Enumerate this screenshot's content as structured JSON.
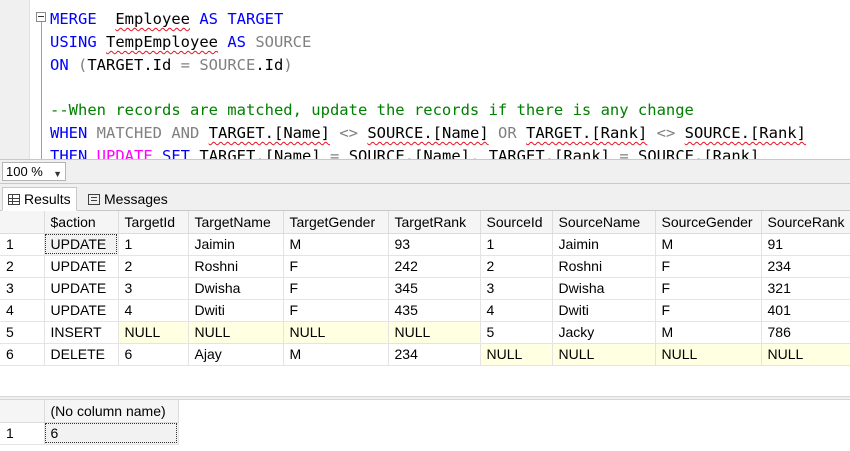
{
  "editor": {
    "lines": [
      [
        [
          "kw",
          "MERGE"
        ],
        [
          "",
          "  "
        ],
        [
          "sq",
          "Employee"
        ],
        [
          "",
          ""
        ],
        [
          "kw",
          " AS TARGET"
        ]
      ],
      [
        [
          "kw",
          "USING"
        ],
        [
          "",
          " "
        ],
        [
          "sq",
          "TempEmployee"
        ],
        [
          "kw",
          " AS"
        ],
        [
          "gr",
          " SOURCE"
        ]
      ],
      [
        [
          "kw",
          "ON"
        ],
        [
          "gr",
          " ("
        ],
        [
          "",
          "TARGET.Id"
        ],
        [
          "gr",
          " = "
        ],
        [
          "gr",
          "SOURCE"
        ],
        [
          "",
          ".Id"
        ],
        [
          "gr",
          ")"
        ]
      ],
      [
        [
          "",
          ""
        ]
      ],
      [
        [
          "cm",
          "--When records are matched, update the records if there is any change"
        ]
      ],
      [
        [
          "kw",
          "WHEN"
        ],
        [
          "gr",
          " MATCHED "
        ],
        [
          "gr",
          "AND"
        ],
        [
          "",
          " "
        ],
        [
          "sq",
          "TARGET"
        ],
        [
          "sq",
          ".[Name]"
        ],
        [
          "gr",
          " <> "
        ],
        [
          "sq",
          "SOURCE"
        ],
        [
          "sq",
          ".[Name]"
        ],
        [
          "gr",
          " OR "
        ],
        [
          "sq",
          "TARGET"
        ],
        [
          "sq",
          ".[Rank]"
        ],
        [
          "gr",
          " <> "
        ],
        [
          "sq",
          "SOURCE"
        ],
        [
          "sq",
          ".[Rank]"
        ]
      ],
      [
        [
          "kw",
          "THEN"
        ],
        [
          "",
          " "
        ],
        [
          "fn",
          "UPDATE"
        ],
        [
          "",
          " "
        ],
        [
          "kw",
          "SET"
        ],
        [
          "",
          " "
        ],
        [
          "sq",
          "TARGET"
        ],
        [
          "sq",
          ".[Name]"
        ],
        [
          "gr",
          " = "
        ],
        [
          "sq",
          "SOURCE"
        ],
        [
          "sq",
          ".[Name]"
        ],
        [
          "gr",
          ", "
        ],
        [
          "sq",
          "TARGET"
        ],
        [
          "sq",
          ".[Rank]"
        ],
        [
          "gr",
          " = "
        ],
        [
          "sq",
          "SOURCE"
        ],
        [
          "sq",
          ".[Rank]"
        ]
      ]
    ]
  },
  "zoom": {
    "value": "100 %"
  },
  "tabs": {
    "results": "Results",
    "messages": "Messages"
  },
  "grid1": {
    "columns": [
      "$action",
      "TargetId",
      "TargetName",
      "TargetGender",
      "TargetRank",
      "SourceId",
      "SourceName",
      "SourceGender",
      "SourceRank"
    ],
    "rows": [
      [
        "1",
        "UPDATE",
        "1",
        "Jaimin",
        "M",
        "93",
        "1",
        "Jaimin",
        "M",
        "91"
      ],
      [
        "2",
        "UPDATE",
        "2",
        "Roshni",
        "F",
        "242",
        "2",
        "Roshni",
        "F",
        "234"
      ],
      [
        "3",
        "UPDATE",
        "3",
        "Dwisha",
        "F",
        "345",
        "3",
        "Dwisha",
        "F",
        "321"
      ],
      [
        "4",
        "UPDATE",
        "4",
        "Dwiti",
        "F",
        "435",
        "4",
        "Dwiti",
        "F",
        "401"
      ],
      [
        "5",
        "INSERT",
        "NULL",
        "NULL",
        "NULL",
        "NULL",
        "5",
        "Jacky",
        "M",
        "786"
      ],
      [
        "6",
        "DELETE",
        "6",
        "Ajay",
        "M",
        "234",
        "NULL",
        "NULL",
        "NULL",
        "NULL"
      ]
    ]
  },
  "grid2": {
    "columns": [
      "(No column name)"
    ],
    "rows": [
      [
        "1",
        "6"
      ]
    ]
  }
}
